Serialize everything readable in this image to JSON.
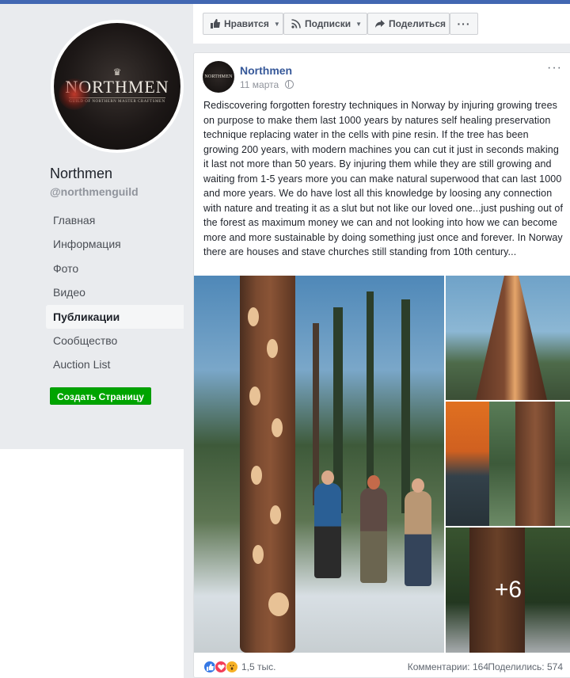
{
  "page": {
    "name": "Northmen",
    "handle": "@northmenguild",
    "logo": {
      "word": "NORTHMEN",
      "subtitle": "GUILD OF NORTHERN MASTER CRAFTSMEN",
      "crown": "♛"
    }
  },
  "nav": {
    "items": [
      {
        "label": "Главная"
      },
      {
        "label": "Информация"
      },
      {
        "label": "Фото"
      },
      {
        "label": "Видео"
      },
      {
        "label": "Публикации"
      },
      {
        "label": "Сообщество"
      },
      {
        "label": "Auction List"
      }
    ],
    "active": "Публикации",
    "create_page_label": "Создать Страницу"
  },
  "action_bar": {
    "like_label": "Нравится",
    "follow_label": "Подписки",
    "share_label": "Поделиться",
    "more_label": "···"
  },
  "post": {
    "author": "Northmen",
    "avatar_text": "NORTHMEN",
    "date": "11 марта",
    "menu": "···",
    "text": "Rediscovering forgotten forestry techniques in Norway by injuring growing trees on purpose to make them last 1000 years by natures self healing preservation technique replacing water in the cells with pine resin. If the tree has been growing 200 years, with modern machines you can cut it just in seconds making it last not more than 50 years. By injuring them while they are still growing and waiting from 1-5 years more you can make natural superwood that can last 1000 and more years. We do have lost all this knowledge by loosing any connection with nature and treating it as a slut but not like our loved one...just pushing out of the forest as maximum money we can and not looking into how we can become more and more sustainable by doing something just once and forever. In Norway there are houses and stave churches still standing from 10th century...",
    "extra_photos": "+6",
    "reactions": {
      "count": "1,5 тыс.",
      "comments": "Комментарии: 164",
      "shares": "Поделились: 574"
    }
  },
  "colors": {
    "brand_blue": "#4267b2",
    "link_blue": "#365899",
    "create_green": "#00a400",
    "like_blue": "#3578e5",
    "love_red": "#f33e58",
    "wow_yellow": "#f7b125"
  }
}
